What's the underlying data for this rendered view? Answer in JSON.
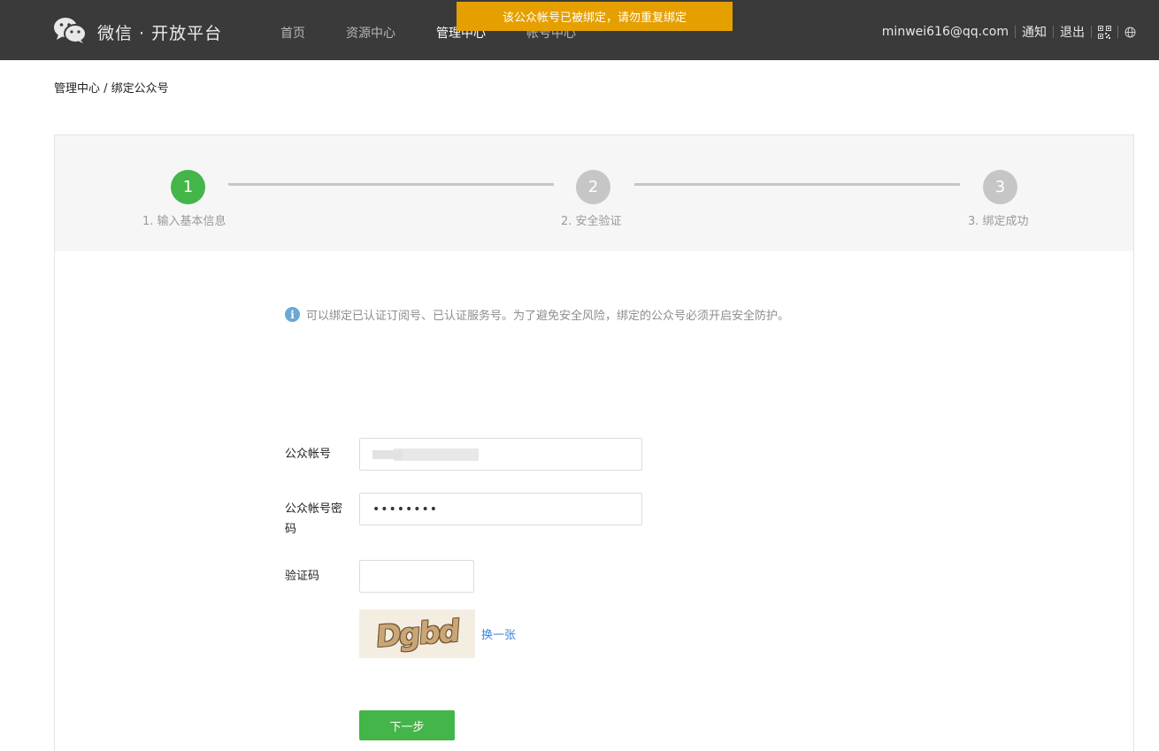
{
  "header": {
    "logo_text": "微信 · 开放平台",
    "nav": [
      {
        "label": "首页",
        "active": false
      },
      {
        "label": "资源中心",
        "active": false
      },
      {
        "label": "管理中心",
        "active": true
      },
      {
        "label": "帐号中心",
        "active": false
      }
    ],
    "user_email": "minwei616@qq.com",
    "notifications_label": "通知",
    "logout_label": "退出",
    "icons": [
      "wechat-logo-icon",
      "qrcode-icon",
      "globe-icon"
    ]
  },
  "toast": {
    "message": "该公众帐号已被绑定，请勿重复绑定",
    "color": "#e5a000"
  },
  "breadcrumb": "管理中心 / 绑定公众号",
  "steps": [
    {
      "number": "1",
      "label": "1. 输入基本信息",
      "status": "current"
    },
    {
      "number": "2",
      "label": "2. 安全验证",
      "status": "pending"
    },
    {
      "number": "3",
      "label": "3. 绑定成功",
      "status": "pending"
    }
  ],
  "notice": "可以绑定已认证订阅号、已认证服务号。为了避免安全风险，绑定的公众号必须开启安全防护。",
  "form": {
    "account_label": "公众帐号",
    "password_label_line1": "公众帐号密",
    "password_label_line2": "码",
    "password_value": "••••••••",
    "captcha_label": "验证码",
    "captcha_value": "",
    "captcha_text": "Dgbd",
    "refresh_label": "换一张",
    "next_button": "下一步"
  },
  "colors": {
    "header_bg": "#3a3a3a",
    "primary_green": "#44b549",
    "link_blue": "#3a85d6"
  }
}
